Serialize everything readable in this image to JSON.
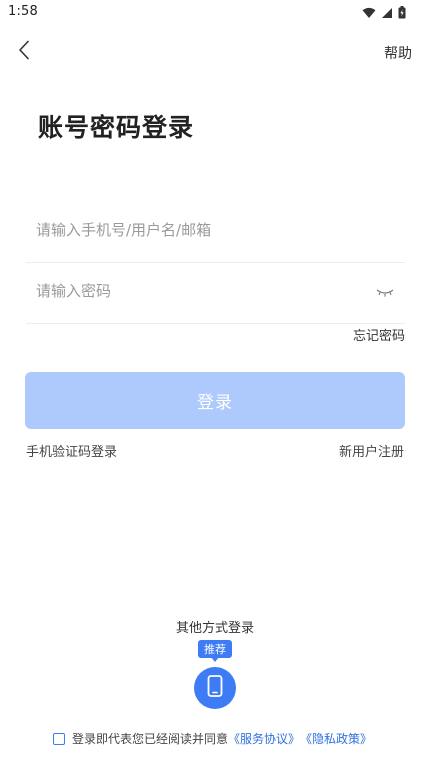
{
  "status_bar": {
    "time": "1:58",
    "icons": [
      "wifi-icon",
      "cellular-signal-icon",
      "battery-charging-icon"
    ]
  },
  "header": {
    "back_icon": "chevron-left-icon",
    "help_label": "帮助"
  },
  "title": "账号密码登录",
  "form": {
    "account_placeholder": "请输入手机号/用户名/邮箱",
    "account_value": "",
    "password_placeholder": "请输入密码",
    "password_value": "",
    "password_visibility_icon": "eye-closed-icon",
    "forgot_label": "忘记密码"
  },
  "login_button_label": "登录",
  "links": {
    "sms_login": "手机验证码登录",
    "register": "新用户注册"
  },
  "other_login": {
    "title": "其他方式登录",
    "badge": "推荐",
    "icon": "mobile-phone-icon"
  },
  "agreement": {
    "checked": false,
    "text": "登录即代表您已经阅读并同意",
    "service_link": "《服务协议》",
    "privacy_link": "《隐私政策》"
  },
  "colors": {
    "accent": "#3d7cf5",
    "login_button_disabled": "#aec9fb",
    "link": "#2f6fe0",
    "divider": "#ededed"
  }
}
